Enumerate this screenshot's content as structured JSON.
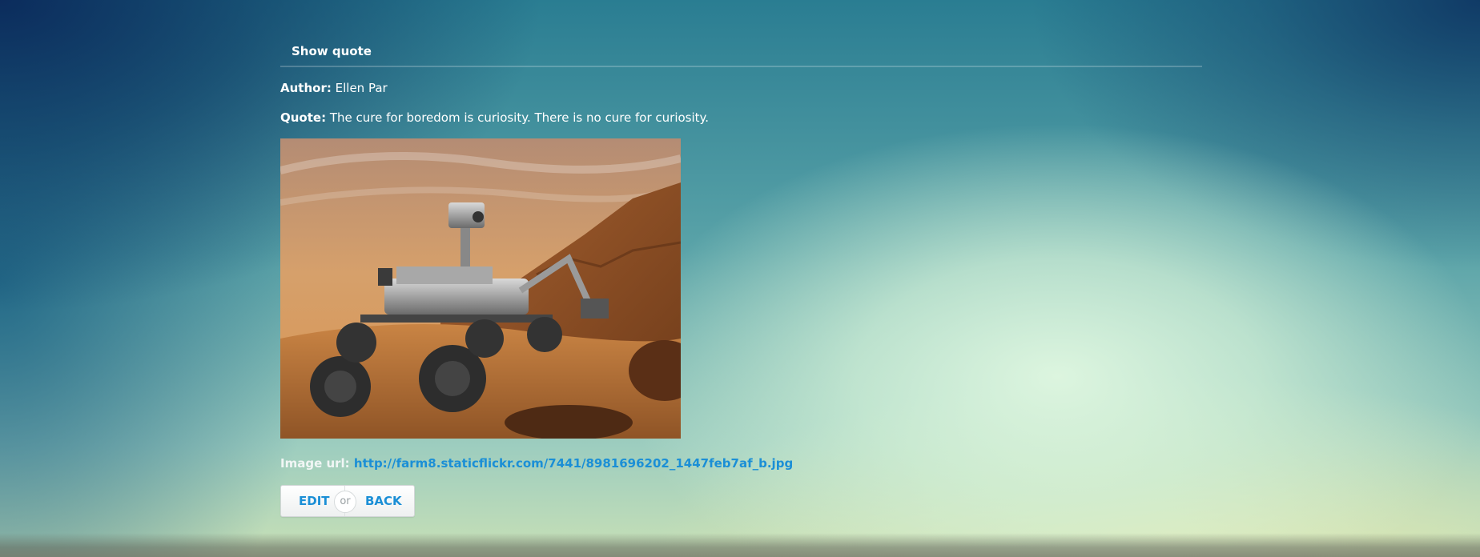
{
  "section": {
    "title": "Show quote"
  },
  "author": {
    "label": "Author:",
    "value": "Ellen Par"
  },
  "quote": {
    "label": "Quote:",
    "value": "The cure for boredom is curiosity. There is no cure for curiosity."
  },
  "image": {
    "alt": "Mars rover on rocky terrain"
  },
  "image_url": {
    "label": "Image url:",
    "value": "http://farm8.staticflickr.com/7441/8981696202_1447feb7af_b.jpg"
  },
  "actions": {
    "edit_label": "EDIT",
    "or_label": "or",
    "back_label": "BACK"
  },
  "colors": {
    "link": "#1b8fd6",
    "text": "#ffffff"
  }
}
